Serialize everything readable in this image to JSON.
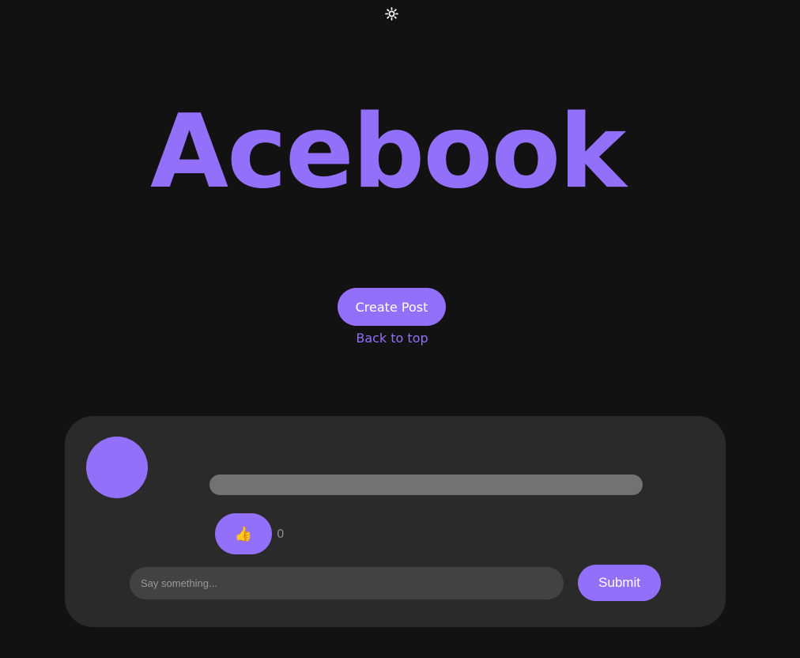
{
  "header": {
    "theme_toggle_icon": "sun-icon",
    "logo_text": "Acebook"
  },
  "actions": {
    "create_post_label": "Create Post",
    "back_to_top_label": "Back to top"
  },
  "post": {
    "avatar_color": "#9370fa",
    "like_icon": "👍",
    "like_count": "0",
    "comment_placeholder": "Say something...",
    "submit_label": "Submit"
  },
  "colors": {
    "accent": "#9370fa",
    "background": "#121212",
    "card": "#2a2a2a",
    "input": "#424242",
    "placeholder_bar": "#727272"
  }
}
